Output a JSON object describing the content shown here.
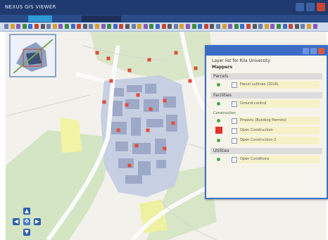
{
  "window": {
    "title": "NEXUS GIS VIEWER"
  },
  "menu": {
    "items": [
      "",
      "",
      "",
      ""
    ]
  },
  "layer_panel": {
    "title": "",
    "header": "Layer list for Rila University",
    "subheader": "Mappers",
    "sections": [
      {
        "name": "Parcels",
        "sub": "",
        "rows": [
          {
            "symbol": "dot-green",
            "label": "Parcel outlines (2016)"
          }
        ]
      },
      {
        "name": "Facilities",
        "sub": "",
        "rows": [
          {
            "symbol": "dot-green",
            "label": "Ground control"
          }
        ]
      },
      {
        "name": "",
        "sub": "Construction",
        "rows": [
          {
            "symbol": "dot-green",
            "label": "Projects (Building Permits)"
          },
          {
            "symbol": "square-red",
            "label": "Open Construction"
          },
          {
            "symbol": "dot-green",
            "label": "Open Construction 2"
          }
        ]
      },
      {
        "name": "Utilities",
        "sub": "",
        "rows": [
          {
            "symbol": "dot-green",
            "label": "Open Conditions"
          }
        ]
      }
    ]
  },
  "map": {
    "point_color": "#e44b3a",
    "building_color": "#9ea9c8",
    "road_color": "#fbfbfb",
    "park_color": "#cfe3bf",
    "water_color": "#f2f4a3"
  },
  "navigator": {
    "up": "▲",
    "down": "▼",
    "left": "◀",
    "right": "▶",
    "center": "✥"
  },
  "colors": {
    "titlebar": "#1f3a6e",
    "menubar": "#2a4c8a",
    "toolbar": "#cfdcf0",
    "dialog_border": "#3d6fc4"
  }
}
